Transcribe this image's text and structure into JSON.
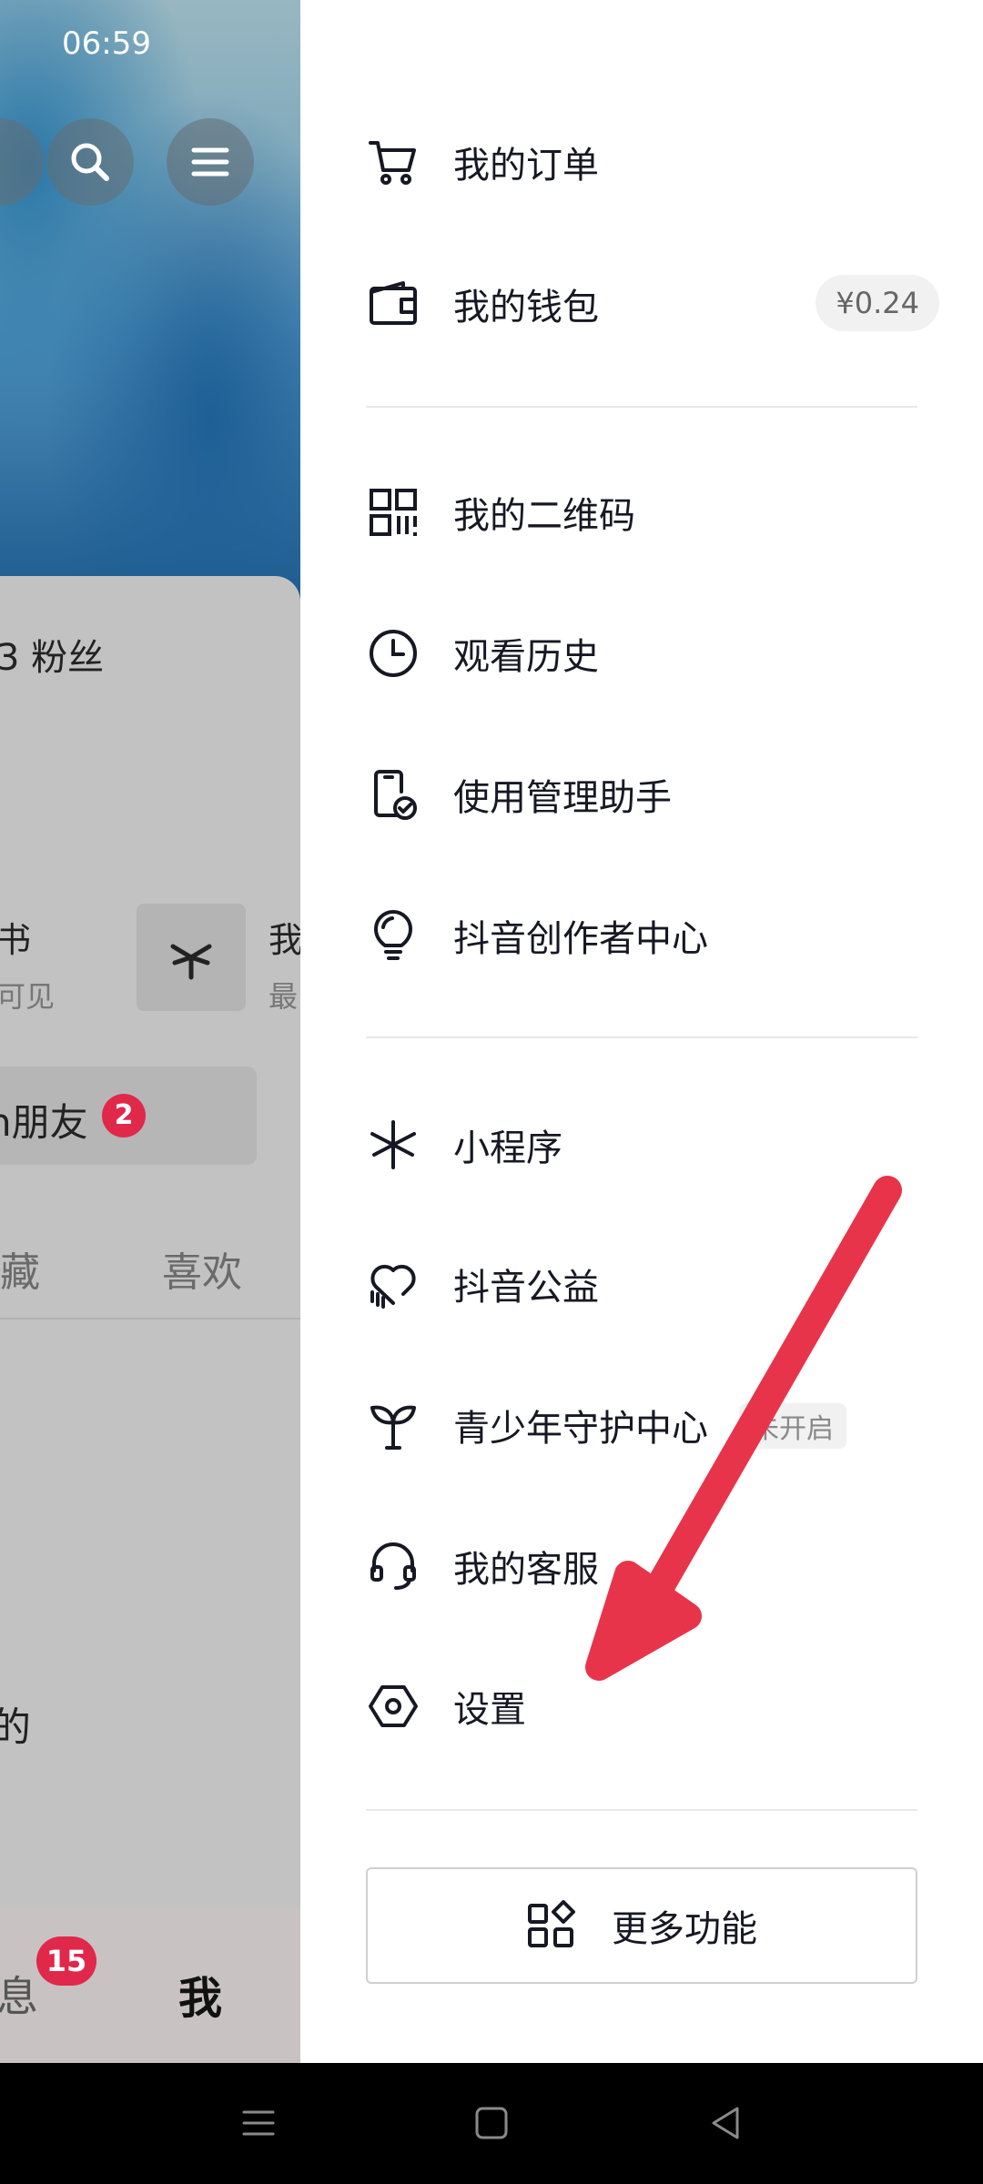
{
  "status_bar": {
    "time": "06:59"
  },
  "background_app": {
    "fans": "3 粉丝",
    "book_title": "书",
    "book_sub": "可见",
    "miniapp_title": "我",
    "miniapp_sub": "最",
    "friends_label": "n朋友",
    "friends_badge": "2",
    "tab_collect": "藏",
    "tab_likes": "喜欢",
    "snippet": "的",
    "tab_messages": "息",
    "messages_badge": "15",
    "tab_me": "我"
  },
  "drawer": {
    "items": [
      {
        "label": "我的订单",
        "icon": "cart-icon"
      },
      {
        "label": "我的钱包",
        "icon": "wallet-icon",
        "value": "¥0.24"
      },
      {
        "label": "我的二维码",
        "icon": "qr-code-icon"
      },
      {
        "label": "观看历史",
        "icon": "clock-icon"
      },
      {
        "label": "使用管理助手",
        "icon": "phone-check-icon"
      },
      {
        "label": "抖音创作者中心",
        "icon": "lightbulb-icon"
      },
      {
        "label": "小程序",
        "icon": "mini-program-icon"
      },
      {
        "label": "抖音公益",
        "icon": "heart-hand-icon"
      },
      {
        "label": "青少年守护中心",
        "icon": "sprout-icon",
        "tag": "未开启"
      },
      {
        "label": "我的客服",
        "icon": "headset-icon"
      },
      {
        "label": "设置",
        "icon": "hexagon-gear-icon"
      }
    ],
    "more_button": "更多功能"
  },
  "colors": {
    "annotation_arrow": "#e8344a",
    "badge": "#e0284a"
  }
}
